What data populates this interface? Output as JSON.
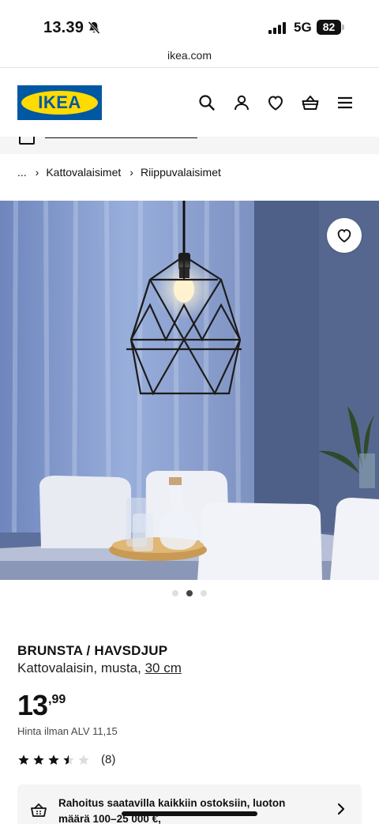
{
  "status_bar": {
    "time": "13.39",
    "network": "5G",
    "battery": "82"
  },
  "browser": {
    "url": "ikea.com"
  },
  "header": {
    "logo_text": "IKEA",
    "brand_colors": {
      "blue": "#0058a3",
      "yellow": "#ffdb00"
    },
    "icons": [
      "search-icon",
      "account-icon",
      "favourites-icon",
      "basket-icon",
      "menu-icon"
    ]
  },
  "breadcrumb": {
    "ellipsis": "...",
    "items": [
      "Kattovalaisimet",
      "Riippuvalaisimet"
    ]
  },
  "gallery": {
    "slide_count": 3,
    "active_slide": 2
  },
  "product": {
    "name": "BRUNSTA / HAVSDJUP",
    "description": "Kattovalaisin, musta, ",
    "size": "30 cm",
    "price_integer": "13",
    "price_decimal": ",99",
    "vat_text": "Hinta ilman ALV 11,15",
    "rating": 3.5,
    "rating_max": 5,
    "review_count": "(8)"
  },
  "financing": {
    "text": "Rahoitus saatavilla kaikkiin ostoksiin, luoton määrä 100–25 000 €,"
  }
}
